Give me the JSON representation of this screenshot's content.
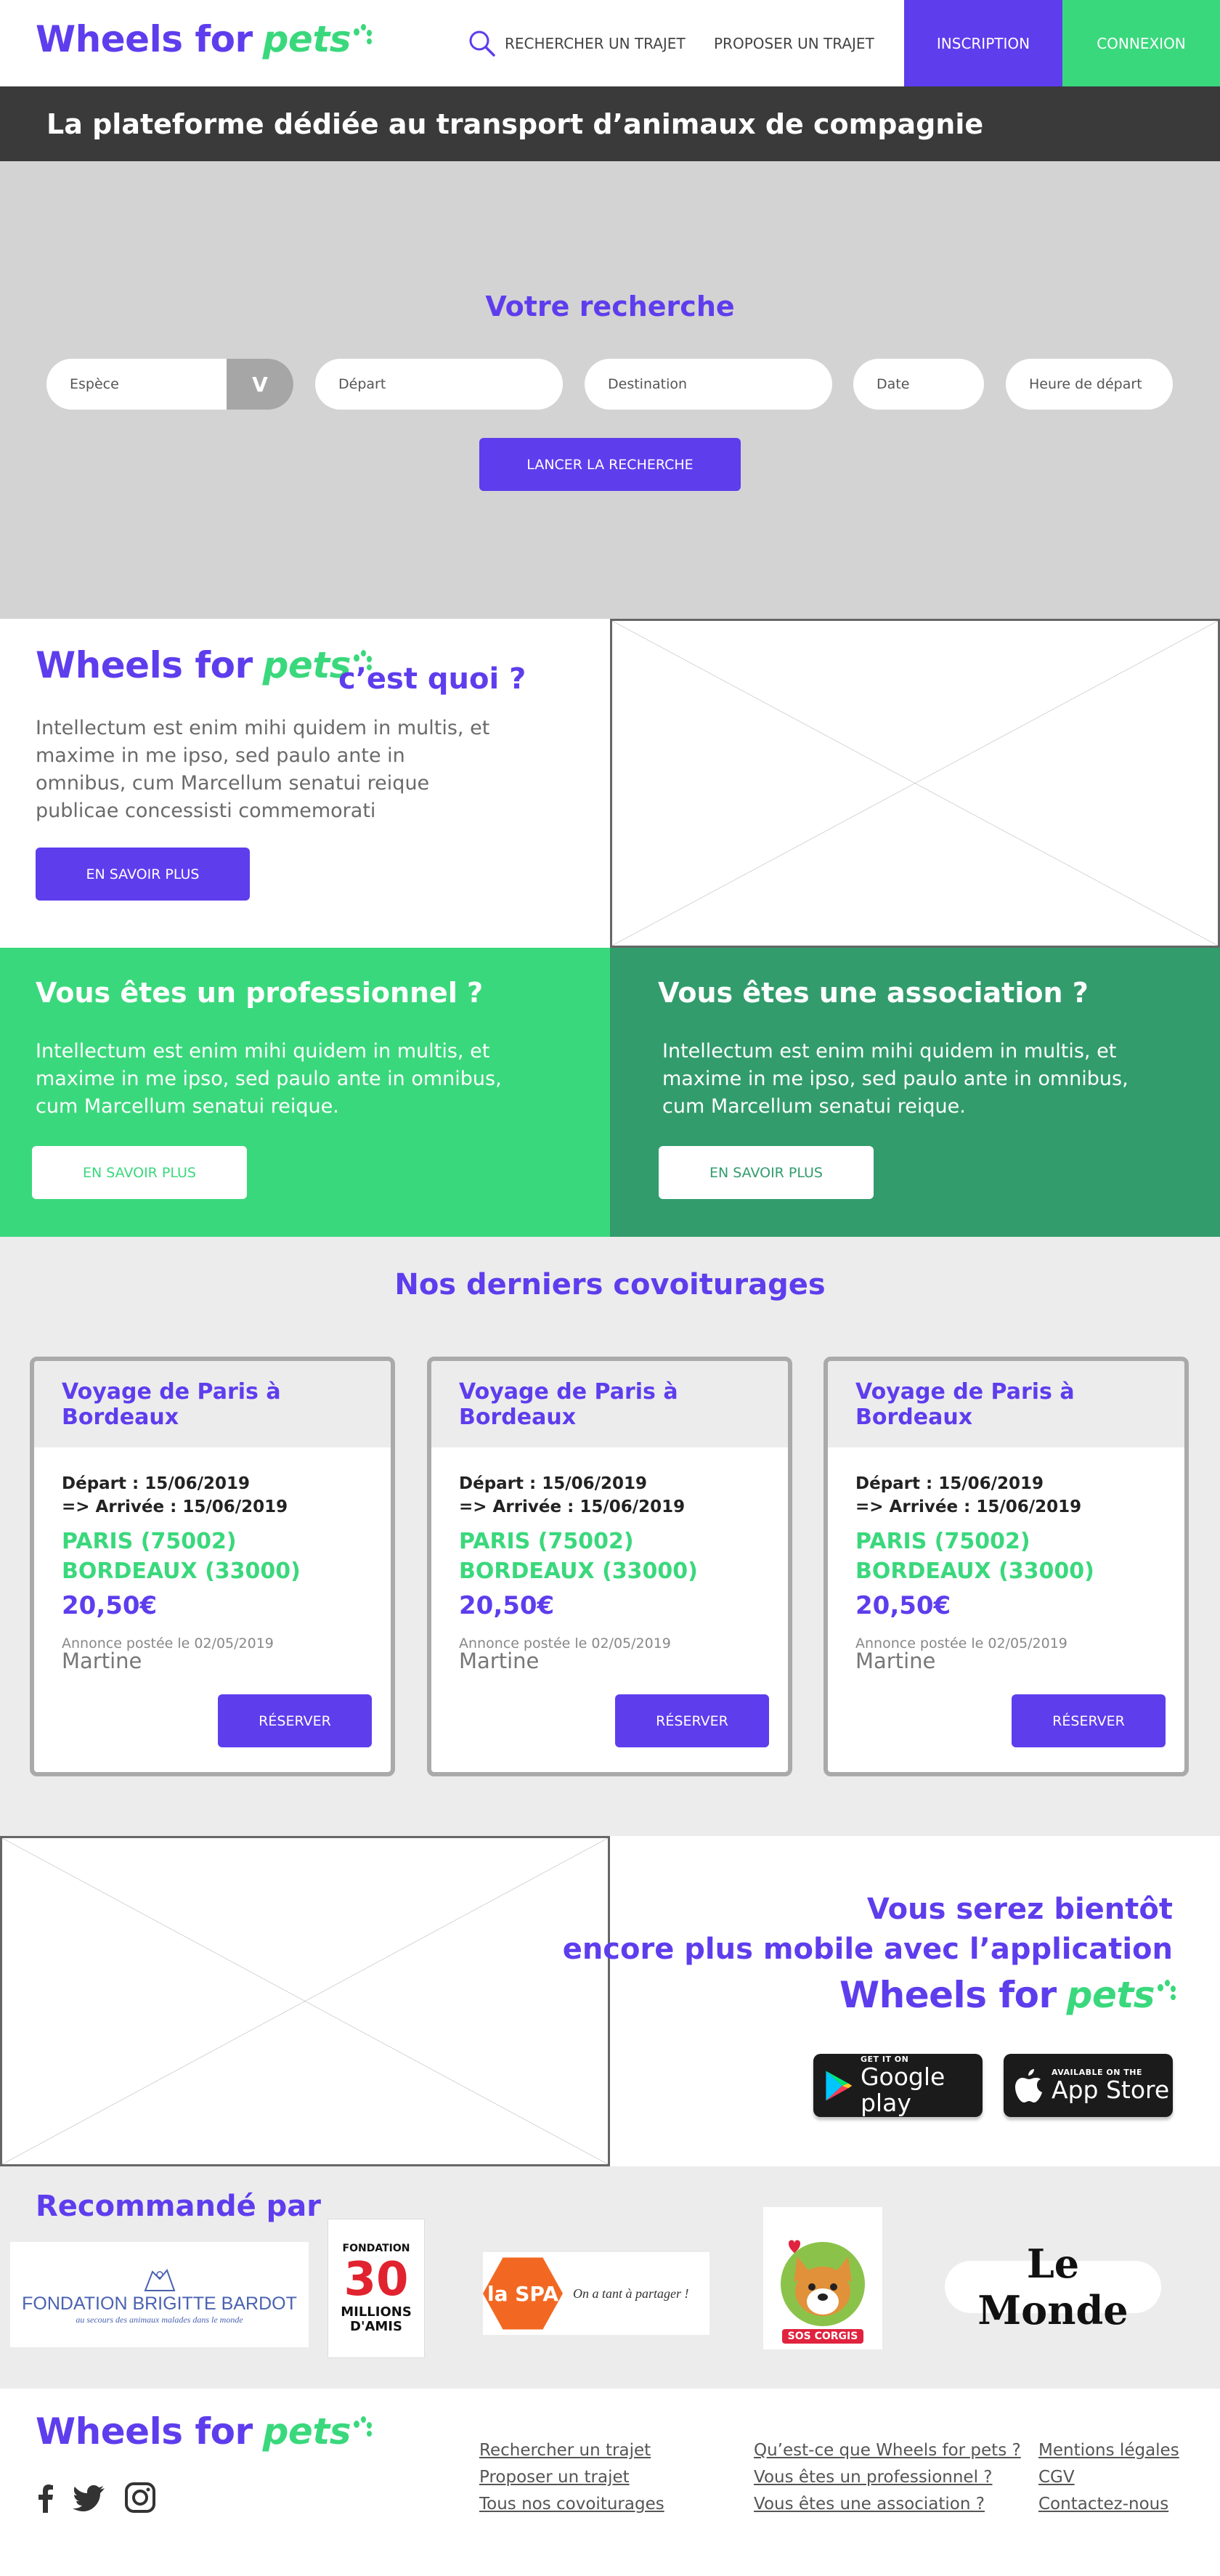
{
  "brand": {
    "word1": "Wheels for",
    "word2": "pets"
  },
  "header": {
    "search_label": "RECHERCHER UN TRAJET",
    "propose_label": "PROPOSER UN TRAJET",
    "signup_label": "INSCRIPTION",
    "login_label": "CONNEXION"
  },
  "tagline": "La plateforme dédiée au transport d’animaux de compagnie",
  "search": {
    "title": "Votre recherche",
    "species_placeholder": "Espèce",
    "species_toggle": "V",
    "departure_placeholder": "Départ",
    "destination_placeholder": "Destination",
    "date_placeholder": "Date",
    "time_placeholder": "Heure de départ",
    "submit_label": "LANCER LA RECHERCHE"
  },
  "whatis": {
    "question": "c’est quoi ?",
    "text": "Intellectum est enim mihi quidem in multis, et maxime in me ipso, sed paulo ante in omnibus, cum Marcellum senatui reique publicae concessisti commemorati",
    "button": "EN SAVOIR PLUS"
  },
  "pro": {
    "title": "Vous êtes un professionnel ?",
    "text": "Intellectum est enim mihi quidem in multis, et maxime in me ipso, sed paulo ante in omnibus, cum Marcellum senatui reique.",
    "button": "EN SAVOIR PLUS"
  },
  "asso": {
    "title": "Vous êtes une association ?",
    "text": "Intellectum est enim mihi quidem in multis, et maxime in me ipso, sed paulo ante in omnibus, cum Marcellum senatui reique.",
    "button": "EN SAVOIR PLUS"
  },
  "rides": {
    "title": "Nos derniers covoiturages",
    "cards": [
      {
        "title": "Voyage de Paris à Bordeaux",
        "departure": "Départ : 15/06/2019",
        "arrival": "=> Arrivée : 15/06/2019",
        "from": "PARIS (75002)",
        "to": "BORDEAUX (33000)",
        "price": "20,50€",
        "posted": "Annonce postée le 02/05/2019",
        "user": "Martine",
        "button": "RÉSERVER"
      },
      {
        "title": "Voyage de Paris à Bordeaux",
        "departure": "Départ : 15/06/2019",
        "arrival": "=> Arrivée : 15/06/2019",
        "from": "PARIS (75002)",
        "to": "BORDEAUX (33000)",
        "price": "20,50€",
        "posted": "Annonce postée le 02/05/2019",
        "user": "Martine",
        "button": "RÉSERVER"
      },
      {
        "title": "Voyage de Paris à Bordeaux",
        "departure": "Départ : 15/06/2019",
        "arrival": "=> Arrivée : 15/06/2019",
        "from": "PARIS (75002)",
        "to": "BORDEAUX (33000)",
        "price": "20,50€",
        "posted": "Annonce postée le 02/05/2019",
        "user": "Martine",
        "button": "RÉSERVER"
      }
    ]
  },
  "app": {
    "line1": "Vous serez bientôt",
    "line2": "encore plus mobile avec l’application",
    "google_small": "GET IT ON",
    "google_big": "Google play",
    "apple_small": "AVAILABLE ON THE",
    "apple_big": "App Store"
  },
  "reco": {
    "title": "Recommandé par",
    "partners": {
      "bardot_main": "FONDATION BRIGITTE BARDOT",
      "bardot_sub": "au secours des animaux malades dans le monde",
      "millions_top": "FONDATION",
      "millions_num": "30",
      "millions_name": "MILLIONS D'AMIS",
      "spa_logo": "la SPA",
      "spa_slogan": "On a tant à partager !",
      "soscorgis": "SOS CORGIS",
      "lemonde": "Le Monde"
    }
  },
  "footer": {
    "col1": [
      "Rechercher un trajet",
      "Proposer un trajet",
      "Tous nos covoiturages"
    ],
    "col2": [
      "Qu’est-ce que Wheels for pets ?",
      "Vous êtes un professionnel ?",
      "Vous êtes une association ?"
    ],
    "col3": [
      "Mentions légales",
      "CGV",
      "Contactez-nous"
    ]
  },
  "colors": {
    "purple": "#5e3ded",
    "green": "#3ad87c",
    "dark_green": "#329c6c",
    "dark_bar": "#3a3a3a",
    "search_bg": "#d3d3d3",
    "light_bg": "#ececec"
  },
  "icons": [
    "search-icon",
    "paw-icon",
    "facebook-icon",
    "twitter-icon",
    "instagram-icon",
    "google-play-icon",
    "apple-icon"
  ]
}
